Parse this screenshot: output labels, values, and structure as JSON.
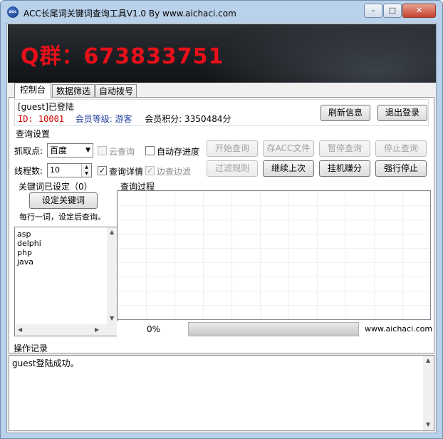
{
  "window": {
    "title": "ACC长尾词关键词查询工具V1.0  By  www.aichaci.com",
    "icon_text": "acc",
    "minimize": "–",
    "maximize": "□",
    "close": "✕"
  },
  "banner": {
    "text": "Q群：673833751"
  },
  "tabs": [
    {
      "label": "控制台",
      "active": true
    },
    {
      "label": "数据筛选",
      "active": false
    },
    {
      "label": "自动拨号",
      "active": false
    }
  ],
  "user": {
    "status": "[guest]已登陆",
    "id_label": "ID: 10001",
    "level_label": "会员等级: 游客",
    "points_label": "会员积分: 3350484分",
    "refresh_button": "刷新信息",
    "logout_button": "退出登录"
  },
  "query": {
    "group_title": "查询设置",
    "grab_label": "抓取点:",
    "grab_value": "百度",
    "cloud_query": "云查询",
    "auto_save": "自动存进度",
    "threads_label": "线程数:",
    "threads_value": "10",
    "query_detail": "查询详情",
    "filter_while": "边查边滤",
    "buttons": {
      "start": "开始查询",
      "save_acc": "存ACC文件",
      "pause": "暂停查询",
      "stop": "停止查询",
      "filter_rules": "过滤规则",
      "continue_last": "继续上次",
      "idle_earn": "挂机赚分",
      "force_stop": "强行停止"
    }
  },
  "keywords": {
    "group_title": "关键词已设定（0）",
    "set_button": "设定关键词",
    "hint": "每行一词，设定后查询。",
    "items": [
      "asp",
      "delphi",
      "php",
      "java"
    ]
  },
  "process": {
    "group_title": "查询过程",
    "percent": "0%",
    "progress": 0,
    "site": "www.aichaci.com"
  },
  "log": {
    "title": "操作记录",
    "lines": [
      "guest登陆成功。"
    ]
  }
}
